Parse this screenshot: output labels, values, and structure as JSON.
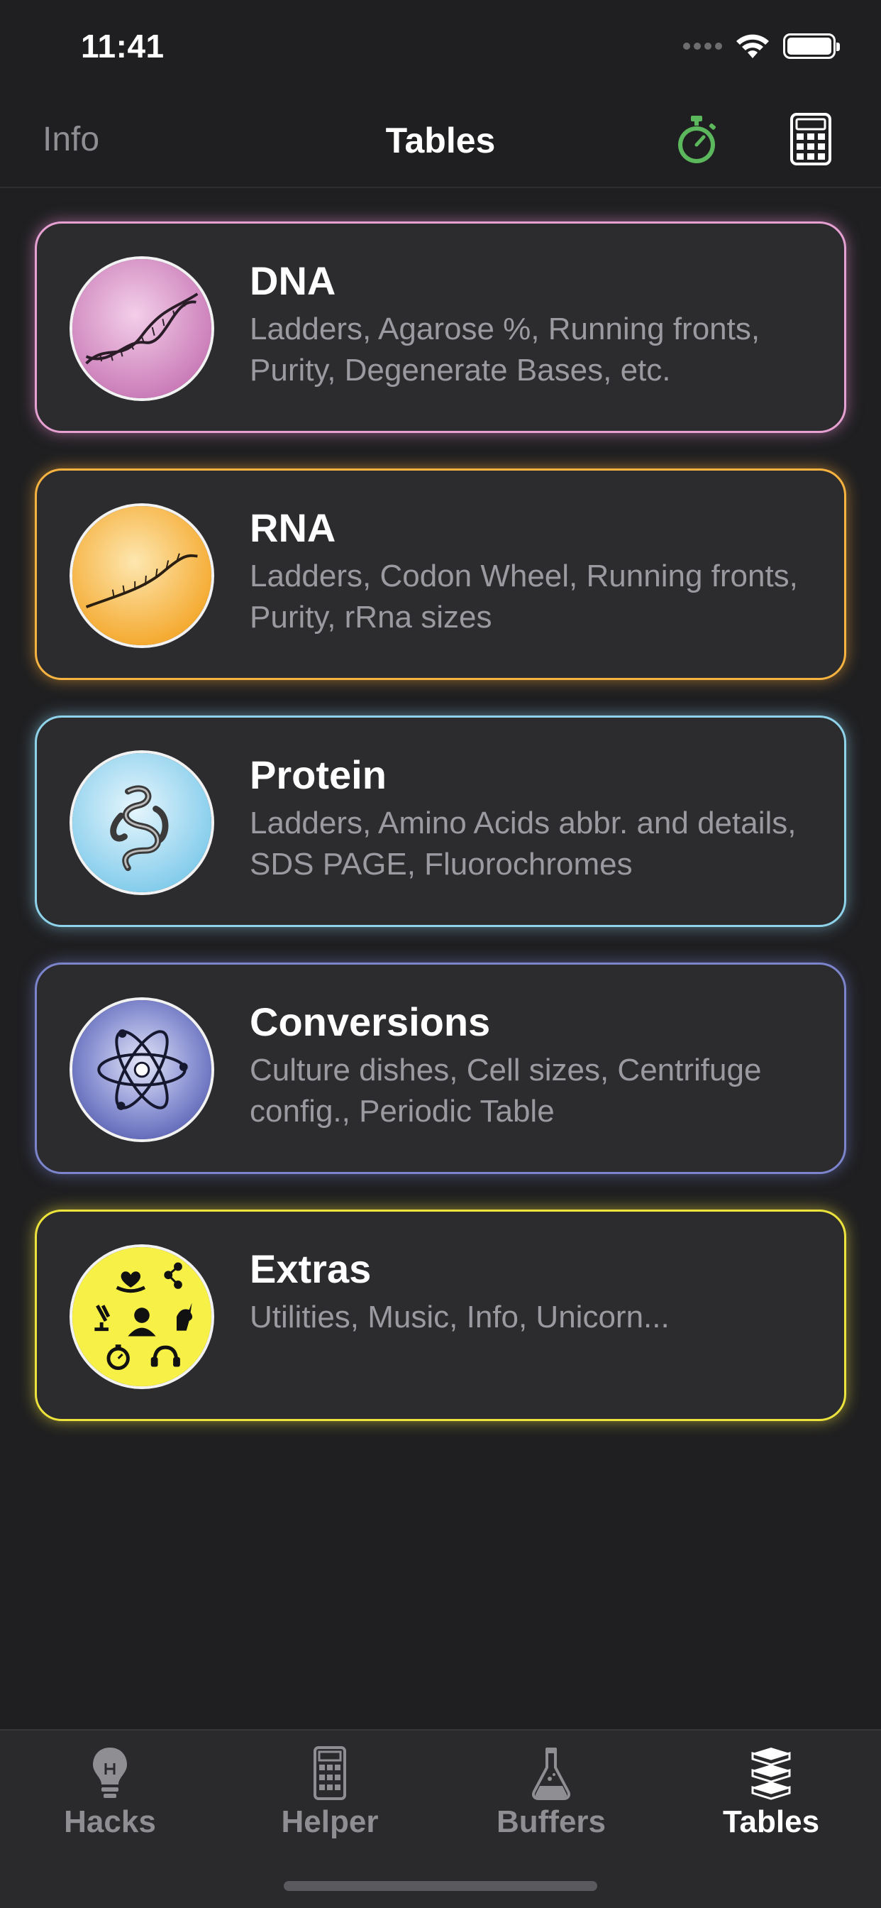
{
  "status_bar": {
    "time": "11:41"
  },
  "nav": {
    "left_label": "Info",
    "title": "Tables",
    "timer_icon": "stopwatch-icon",
    "calculator_icon": "calculator-icon",
    "timer_color": "#5cb85c"
  },
  "cards": [
    {
      "title": "DNA",
      "description": "Ladders, Agarose %, Running fronts, Purity, Degenerate Bases, etc.",
      "accent": "#e6a1d2",
      "image": "dna-helix-image"
    },
    {
      "title": "RNA",
      "description": "Ladders, Codon Wheel, Running fronts, Purity, rRna sizes",
      "accent": "#f7b340",
      "image": "rna-strand-image"
    },
    {
      "title": "Protein",
      "description": "Ladders, Amino Acids abbr. and details, SDS PAGE, Fluorochromes",
      "accent": "#8ed3ea",
      "image": "protein-structure-image"
    },
    {
      "title": "Conversions",
      "description": "Culture dishes, Cell sizes, Centrifuge config., Periodic Table",
      "accent": "#7c84cc",
      "image": "atom-image"
    },
    {
      "title": "Extras",
      "description": "Utilities, Music, Info, Unicorn...",
      "accent": "#ede33d",
      "image": "extras-collage-image"
    }
  ],
  "tab_bar": {
    "tabs": [
      {
        "label": "Hacks",
        "icon": "lightbulb-icon",
        "active": false
      },
      {
        "label": "Helper",
        "icon": "calculator-icon",
        "active": false
      },
      {
        "label": "Buffers",
        "icon": "flask-icon",
        "active": false
      },
      {
        "label": "Tables",
        "icon": "books-icon",
        "active": true
      }
    ]
  }
}
